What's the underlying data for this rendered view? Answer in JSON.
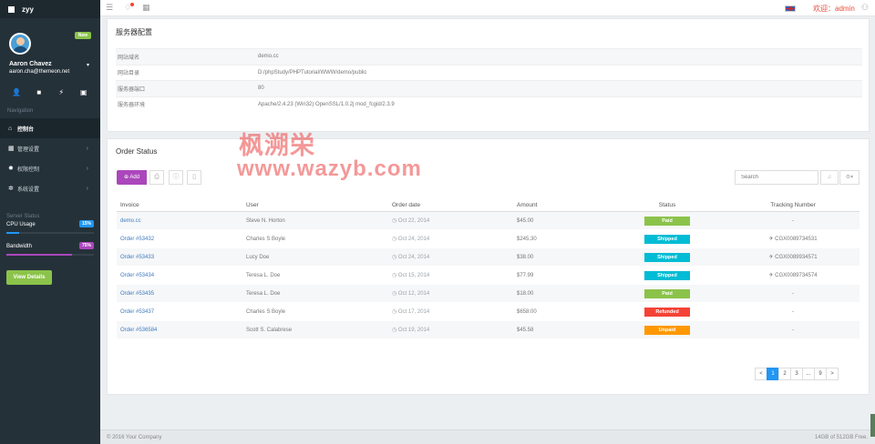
{
  "app": {
    "brand": "zyy",
    "welcome": "欢迎：admin"
  },
  "sidebar": {
    "badge": "New",
    "user_name": "Aaron Chavez",
    "user_email": "aaron.cha@themeon.net",
    "nav_label": "Navigation",
    "items": [
      {
        "label": "控制台",
        "icon": "home-icon"
      },
      {
        "label": "管理设置",
        "icon": "table-icon"
      },
      {
        "label": "权限控制",
        "icon": "cog-icon"
      },
      {
        "label": "系统设置",
        "icon": "settings-icon"
      }
    ],
    "server_status_label": "Server Status",
    "cpu": {
      "label": "CPU Usage",
      "percent": "15%",
      "value": 0.15,
      "color": "#2196f3"
    },
    "bandwidth": {
      "label": "Bandwidth",
      "percent": "75%",
      "value": 0.75,
      "color": "#ab47bc"
    },
    "view_details": "View Details"
  },
  "server_config": {
    "title": "服务器配置",
    "rows": [
      {
        "key": "网站域名",
        "value": "demo.cc"
      },
      {
        "key": "网站目录",
        "value": "D:/phpStudy/PHPTutorial/WWW/demo/public"
      },
      {
        "key": "服务器端口",
        "value": "80"
      },
      {
        "key": "服务器环境",
        "value": "Apache/2.4.23 (Win32) OpenSSL/1.0.2j mod_fcgid/2.3.9"
      }
    ]
  },
  "orders": {
    "title": "Order Status",
    "add_label": "⊕ Add",
    "search_placeholder": "Search",
    "columns": [
      "Invoice",
      "User",
      "Order date",
      "Amount",
      "Status",
      "Tracking Number"
    ],
    "rows": [
      {
        "invoice": "demo.cc",
        "user": "Steve N. Horton",
        "date": "Oct 22, 2014",
        "amount": "$45.00",
        "status": "Paid",
        "status_color": "#8bc34a",
        "tracking": "-"
      },
      {
        "invoice": "Order #53432",
        "user": "Charles S Boyle",
        "date": "Oct 24, 2014",
        "amount": "$245.30",
        "status": "Shipped",
        "status_color": "#00bcd4",
        "tracking": "CGX0089734531"
      },
      {
        "invoice": "Order #53433",
        "user": "Lucy Doe",
        "date": "Oct 24, 2014",
        "amount": "$38.00",
        "status": "Shipped",
        "status_color": "#00bcd4",
        "tracking": "CGX0089934571"
      },
      {
        "invoice": "Order #53434",
        "user": "Teresa L. Doe",
        "date": "Oct 15, 2014",
        "amount": "$77.99",
        "status": "Shipped",
        "status_color": "#00bcd4",
        "tracking": "CGX0089734574"
      },
      {
        "invoice": "Order #53435",
        "user": "Teresa L. Doe",
        "date": "Oct 12, 2014",
        "amount": "$18.00",
        "status": "Paid",
        "status_color": "#8bc34a",
        "tracking": "-"
      },
      {
        "invoice": "Order #53437",
        "user": "Charles S Boyle",
        "date": "Oct 17, 2014",
        "amount": "$658.00",
        "status": "Refunded",
        "status_color": "#f44336",
        "tracking": "-"
      },
      {
        "invoice": "Order #536584",
        "user": "Scott S. Calabrese",
        "date": "Oct 19, 2014",
        "amount": "$45.58",
        "status": "Unpaid",
        "status_color": "#ff9800",
        "tracking": "-"
      }
    ],
    "pagination": [
      "<",
      "1",
      "2",
      "3",
      "...",
      "9",
      ">"
    ],
    "active_page": "1"
  },
  "footer": {
    "copyright": "© 2016 Your Company",
    "storage": "14GB of 512GB Free."
  },
  "watermark": {
    "line1": "枫溯栄",
    "line2": "www.wazyb.com"
  }
}
